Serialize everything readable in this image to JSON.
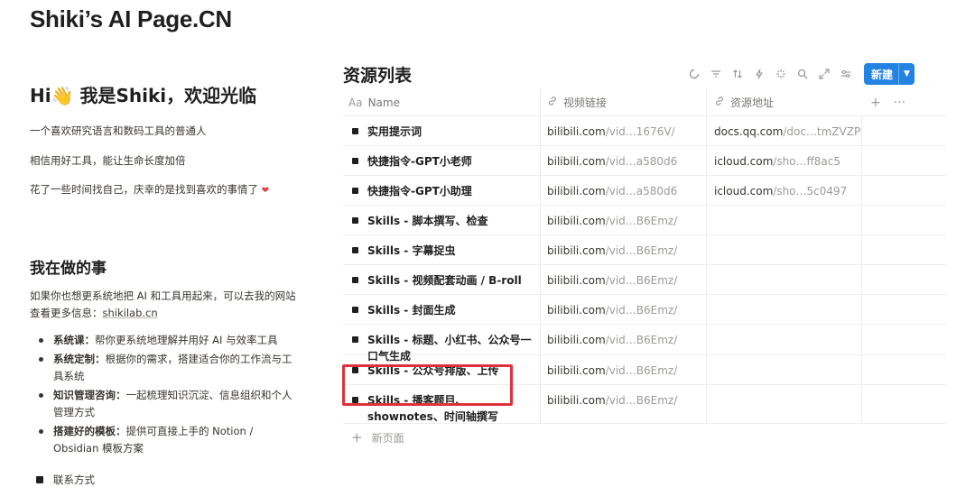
{
  "page_title": "Shiki’s AI Page.CN",
  "left": {
    "hero": "Hi👋 我是Shiki，欢迎光临",
    "lines": [
      "一个喜欢研究语言和数码工具的普通人",
      "相信用好工具，能让生命长度加倍",
      "花了一些时间找自己，庆幸的是找到喜欢的事情了"
    ],
    "heart": "❤",
    "section_title": "我在做的事",
    "intro_text": "如果你也想更系统地把 AI 和工具用起来，可以去我的网站查看更多信息：",
    "intro_link": "shikilab.cn",
    "bullets": [
      {
        "label": "系统课：",
        "text": "帮你更系统地理解并用好 AI 与效率工具"
      },
      {
        "label": "系统定制：",
        "text": "根据你的需求，搭建适合你的工作流与工具系统"
      },
      {
        "label": "知识管理咨询：",
        "text": "一起梳理知识沉淀、信息组织和个人管理方式"
      },
      {
        "label": "搭建好的模板：",
        "text": "提供可直接上手的 Notion / Obsidian 模板方案"
      }
    ],
    "contact": "联系方式"
  },
  "database": {
    "title": "资源列表",
    "new_button": "新建",
    "columns": {
      "name_icon": "Aa",
      "name": "Name",
      "video": "视频链接",
      "resource": "资源地址"
    },
    "new_page": "新页面",
    "rows": [
      {
        "name": "实用提示词",
        "video_a": "bilibili.com",
        "video_b": "/vid…1676V/",
        "res_a": "docs.qq.com",
        "res_b": "/doc…tmZVZP"
      },
      {
        "name": "快捷指令-GPT小老师",
        "video_a": "bilibili.com",
        "video_b": "/vid…a580d6",
        "res_a": "icloud.com",
        "res_b": "/sho…ff8ac5"
      },
      {
        "name": "快捷指令-GPT小助理",
        "video_a": "bilibili.com",
        "video_b": "/vid…a580d6",
        "res_a": "icloud.com",
        "res_b": "/sho…5c0497"
      },
      {
        "name": "Skills - 脚本撰写、检查",
        "video_a": "bilibili.com",
        "video_b": "/vid…B6Emz/",
        "res_a": "",
        "res_b": ""
      },
      {
        "name": "Skills - 字幕捉虫",
        "video_a": "bilibili.com",
        "video_b": "/vid…B6Emz/",
        "res_a": "",
        "res_b": ""
      },
      {
        "name": "Skills - 视频配套动画 / B-roll",
        "video_a": "bilibili.com",
        "video_b": "/vid…B6Emz/",
        "res_a": "",
        "res_b": ""
      },
      {
        "name": "Skills - 封面生成",
        "video_a": "bilibili.com",
        "video_b": "/vid…B6Emz/",
        "res_a": "",
        "res_b": ""
      },
      {
        "name": "Skills - 标题、小红书、公众号一口气生成",
        "video_a": "bilibili.com",
        "video_b": "/vid…B6Emz/",
        "res_a": "",
        "res_b": ""
      },
      {
        "name": "Skills - 公众号排版、上传",
        "video_a": "bilibili.com",
        "video_b": "/vid…B6Emz/",
        "res_a": "",
        "res_b": ""
      },
      {
        "name": "Skills - 播客题目、shownotes、时间轴撰写",
        "video_a": "bilibili.com",
        "video_b": "/vid…B6Emz/",
        "res_a": "",
        "res_b": ""
      }
    ]
  },
  "colors": {
    "accent": "#2383e2",
    "highlight": "#e0313b"
  }
}
